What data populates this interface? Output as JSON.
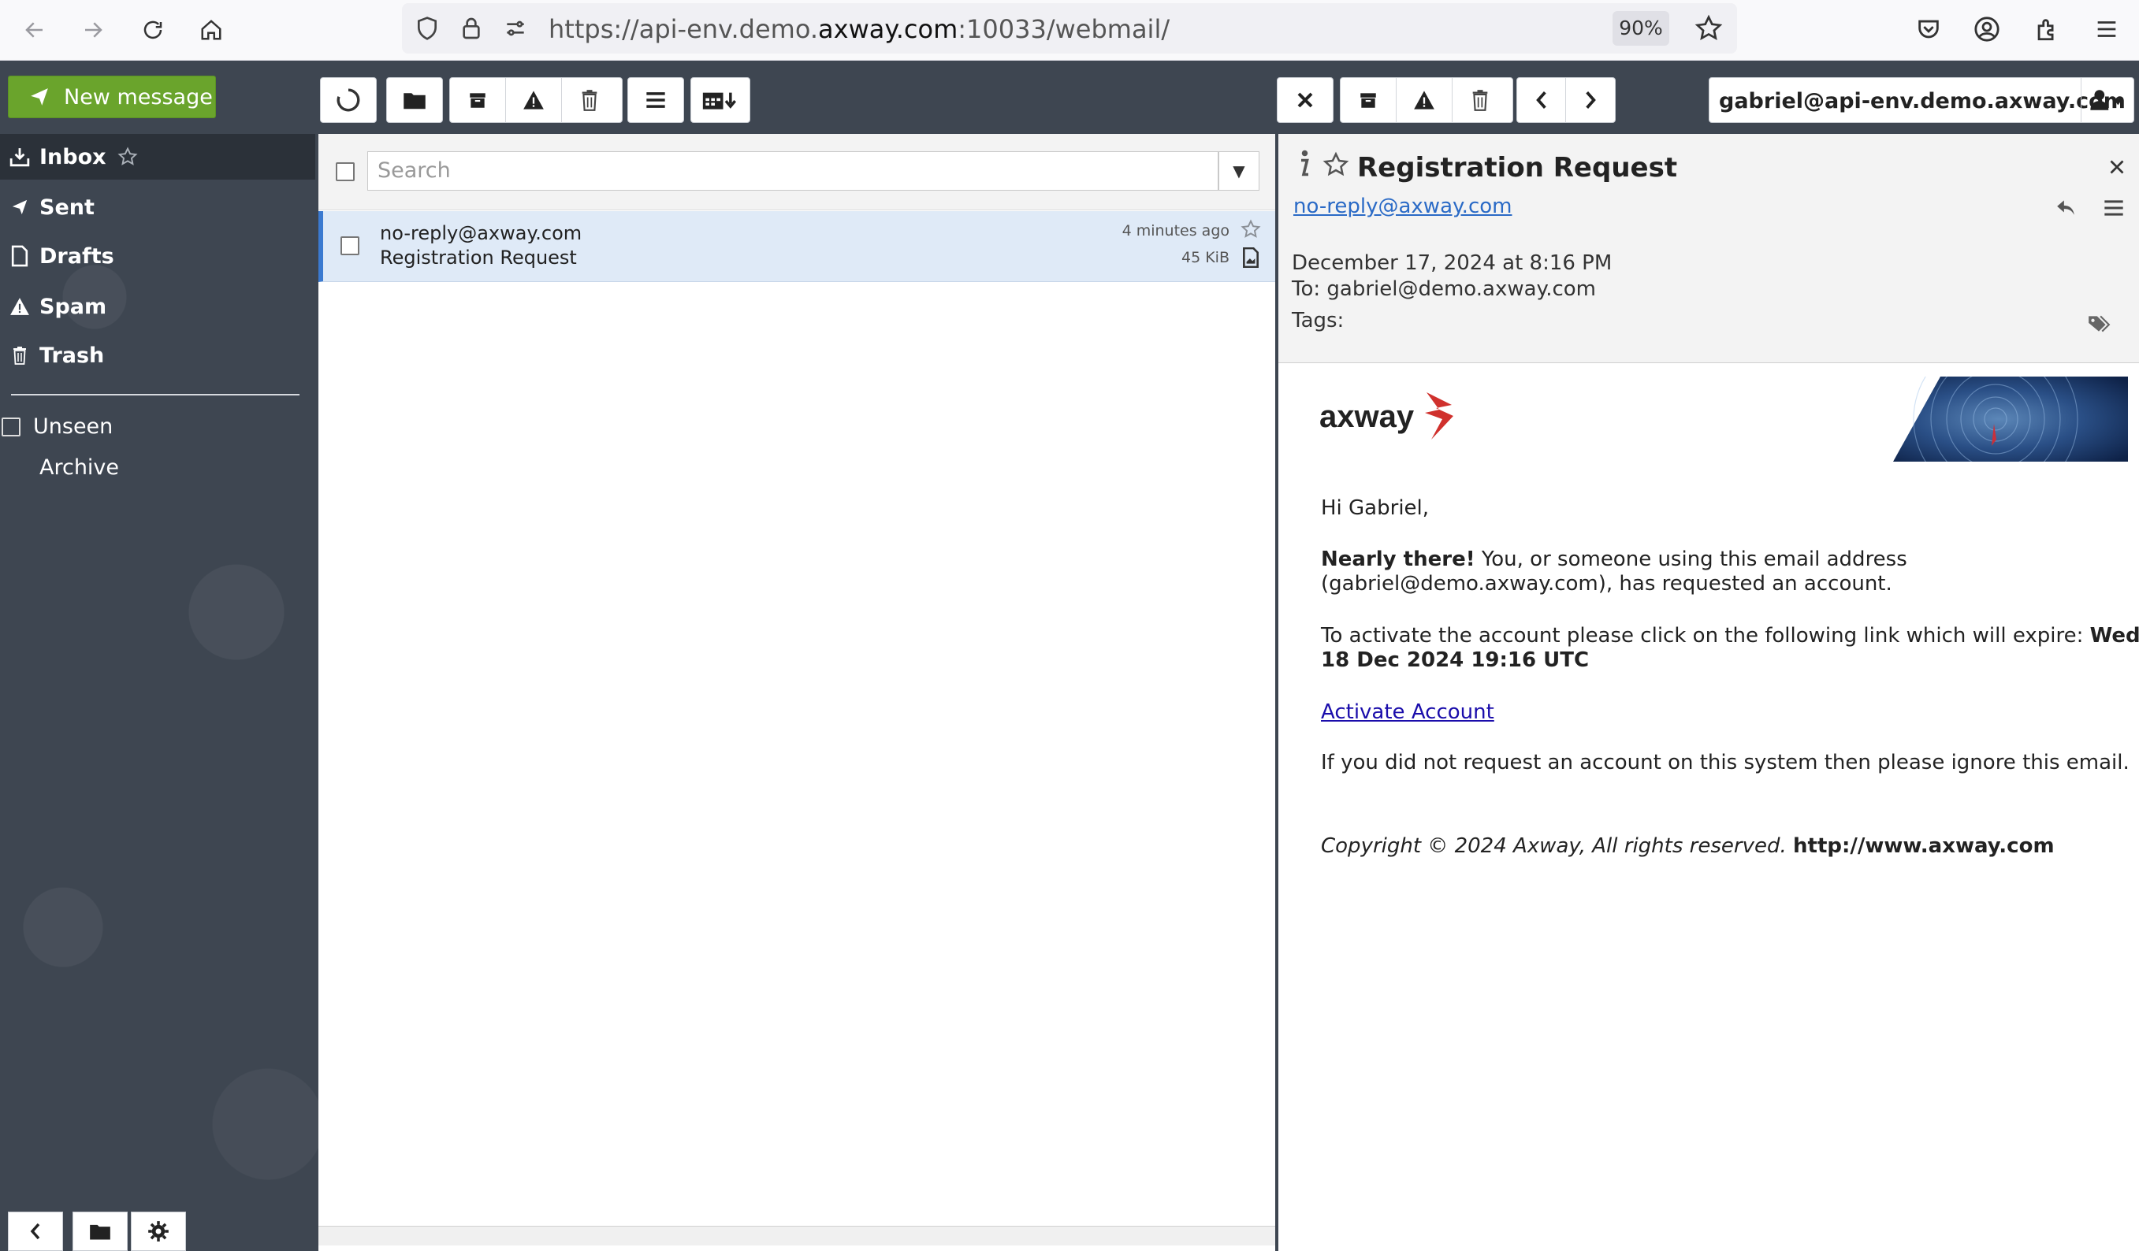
{
  "browser": {
    "url_prefix": "https://api-env.demo.",
    "url_domain": "axway.com",
    "url_suffix": ":10033/webmail/",
    "zoom": "90%"
  },
  "toolbar": {
    "new_message": "New message"
  },
  "sidebar": {
    "folders": [
      {
        "label": "Inbox",
        "icon": "inbox-icon",
        "active": true
      },
      {
        "label": "Sent",
        "icon": "send-icon"
      },
      {
        "label": "Drafts",
        "icon": "draft-icon"
      },
      {
        "label": "Spam",
        "icon": "warning-icon"
      },
      {
        "label": "Trash",
        "icon": "trash-icon"
      }
    ],
    "unseen": "Unseen",
    "archive": "Archive"
  },
  "list": {
    "search_placeholder": "Search",
    "messages": [
      {
        "from": "no-reply@axway.com",
        "subject": "Registration Request",
        "time": "4 minutes ago",
        "size": "45 KiB"
      }
    ]
  },
  "account": {
    "email": "gabriel@api-env.demo.axway.com"
  },
  "message": {
    "subject": "Registration Request",
    "from": "no-reply@axway.com",
    "date": "December 17, 2024 at 8:16 PM",
    "to": "To: gabriel@demo.axway.com",
    "tags_label": "Tags:",
    "body": {
      "logo_text": "axway",
      "greeting": "Hi Gabriel,",
      "p1_bold": "Nearly there!",
      "p1_rest": " You, or someone using this email address",
      "p1_line2": "(gabriel@demo.axway.com), has requested an account.",
      "p2_line1": "To activate the account please click on the following link which will expire: ",
      "p2_bold1": "Wed,",
      "p2_bold2": "18 Dec 2024 19:16 UTC",
      "activate_link": "Activate Account",
      "p3": "If you did not request an account on this system then please ignore this email.",
      "copyright": "Copyright © 2024 Axway, All rights reserved. ",
      "website": "http://www.axway.com"
    }
  },
  "colors": {
    "new_message_bg": "#6aa42c",
    "sidebar_bg": "#3e4651",
    "selected_row": "#dfeaf7",
    "link": "#2a6ac6",
    "axway_red": "#d0312d"
  }
}
